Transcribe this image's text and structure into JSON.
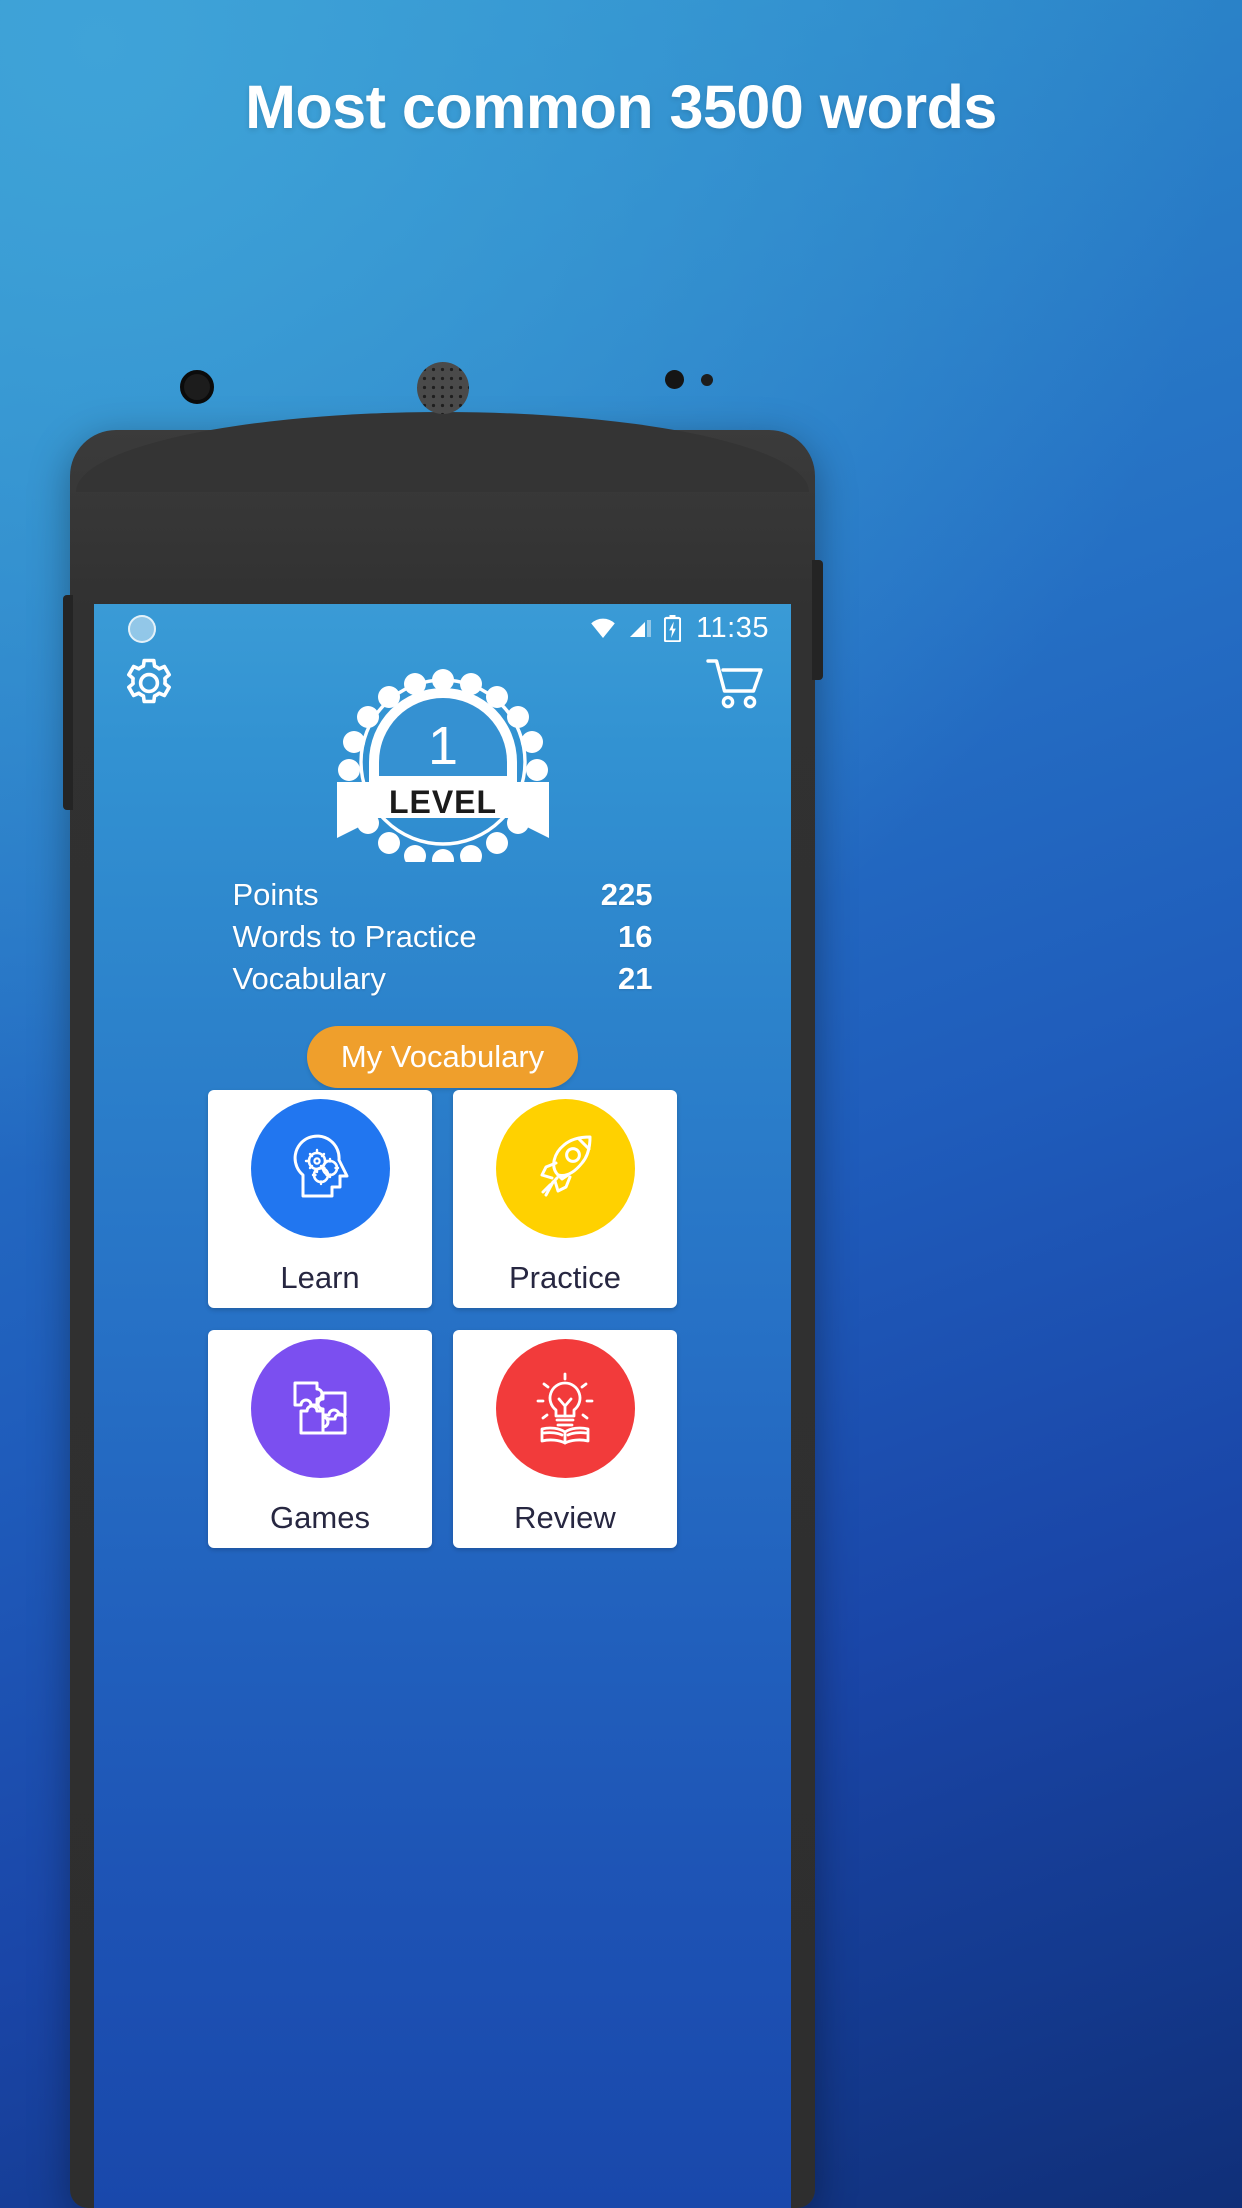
{
  "promo": {
    "headline": "Most common 3500 words"
  },
  "status_bar": {
    "time": "11:35",
    "icons": [
      "wifi-icon",
      "cellular-signal-icon",
      "battery-charging-icon"
    ]
  },
  "app_bar": {
    "settings_icon": "gear-icon",
    "cart_icon": "shopping-cart-icon"
  },
  "level_badge": {
    "number": "1",
    "label": "LEVEL"
  },
  "stats": {
    "rows": [
      {
        "label": "Points",
        "value": "225"
      },
      {
        "label": "Words to Practice",
        "value": "16"
      },
      {
        "label": "Vocabulary",
        "value": "21"
      }
    ],
    "button_label": "My Vocabulary",
    "button_color": "#EF9F2C"
  },
  "menu": {
    "cards": [
      {
        "label": "Learn",
        "icon": "head-with-gears-icon",
        "color": "#2176F0"
      },
      {
        "label": "Practice",
        "icon": "rocket-icon",
        "color": "#FFD100"
      },
      {
        "label": "Games",
        "icon": "puzzle-pieces-icon",
        "color": "#7B4FF0"
      },
      {
        "label": "Review",
        "icon": "lightbulb-book-icon",
        "color": "#F23B3B"
      }
    ]
  },
  "theme": {
    "background_top": "#3aa0d7",
    "background_bottom": "#102f78",
    "card_background": "#ffffff",
    "label_color": "#272741"
  }
}
